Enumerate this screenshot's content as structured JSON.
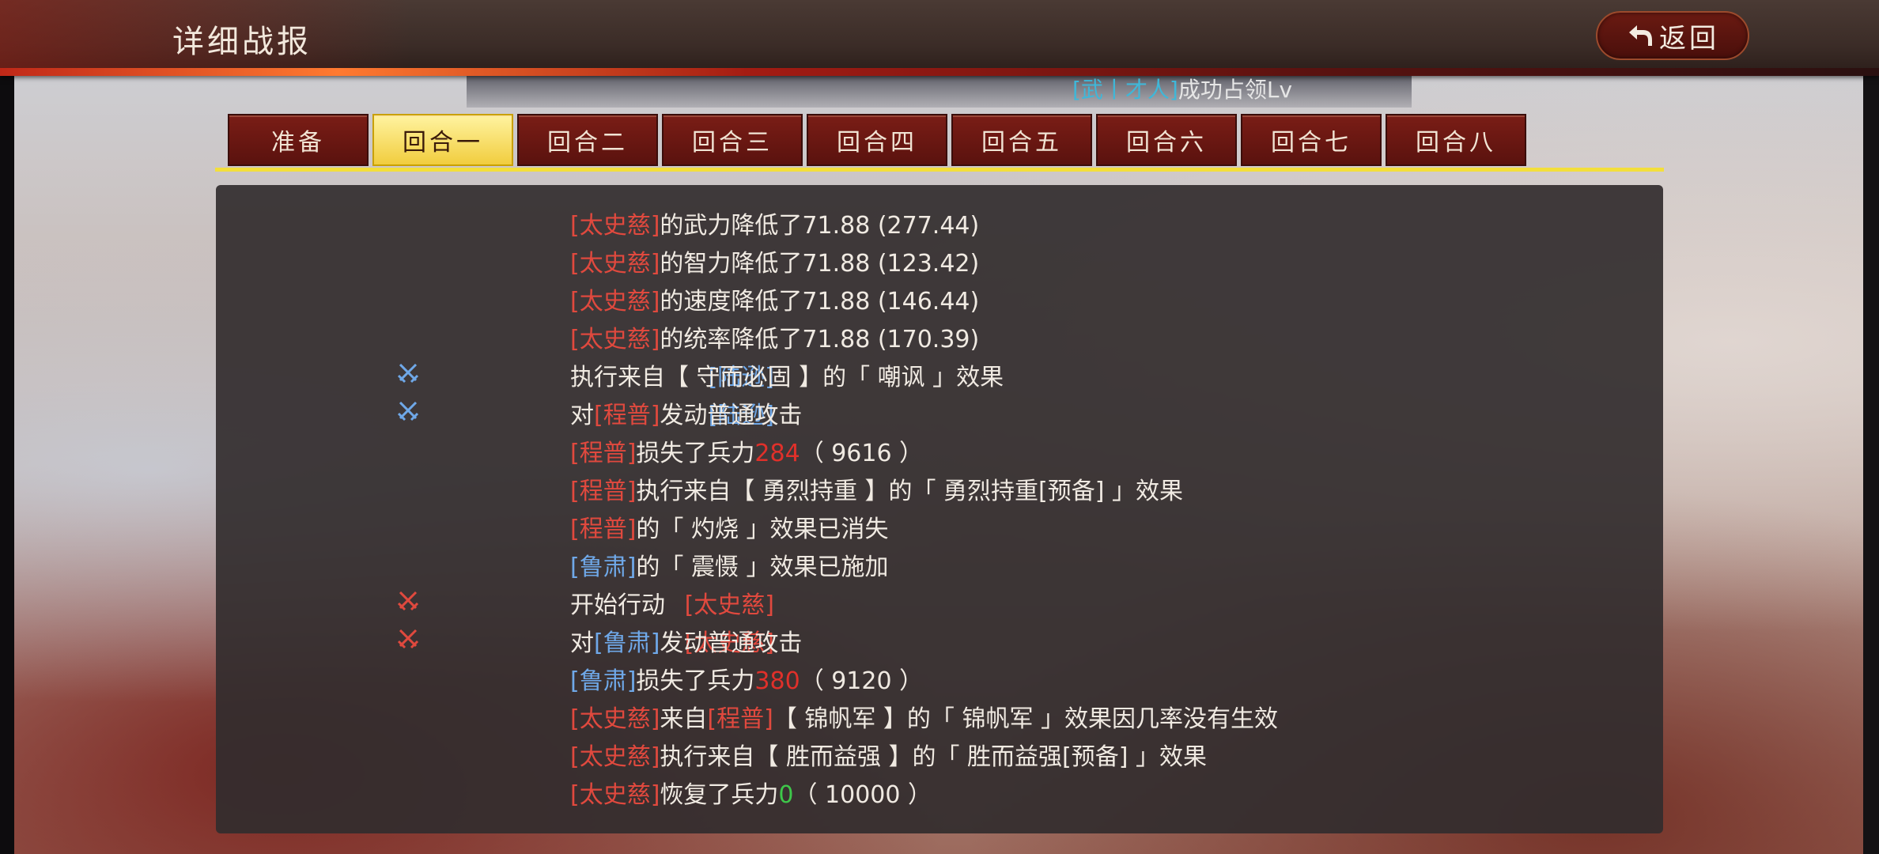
{
  "header": {
    "title": "详细战报",
    "back_label": "返回"
  },
  "occupy_notice": {
    "bracket_name": "[武丨才人]",
    "text": "成功占领Lv"
  },
  "tabs": [
    "准备",
    "回合一",
    "回合二",
    "回合三",
    "回合四",
    "回合五",
    "回合六",
    "回合七",
    "回合八"
  ],
  "active_tab": 1,
  "colors": {
    "red_name": "#e0493e",
    "blue_name": "#6fa8e8",
    "loss": "#e0302a",
    "heal": "#3ec74a",
    "tab_active": "#f3df3b"
  },
  "log": [
    {
      "icon": "",
      "actor": "",
      "actor_color": "",
      "segments": [
        {
          "t": "[太史慈]",
          "c": "red"
        },
        {
          "t": "的武力降低了71.88 (277.44)"
        }
      ]
    },
    {
      "icon": "",
      "actor": "",
      "actor_color": "",
      "segments": [
        {
          "t": "[太史慈]",
          "c": "red"
        },
        {
          "t": "的智力降低了71.88 (123.42)"
        }
      ]
    },
    {
      "icon": "",
      "actor": "",
      "actor_color": "",
      "segments": [
        {
          "t": "[太史慈]",
          "c": "red"
        },
        {
          "t": "的速度降低了71.88 (146.44)"
        }
      ]
    },
    {
      "icon": "",
      "actor": "",
      "actor_color": "",
      "segments": [
        {
          "t": "[太史慈]",
          "c": "red"
        },
        {
          "t": "的统率降低了71.88 (170.39)"
        }
      ]
    },
    {
      "icon": "crossed-swords-blue",
      "actor": "[陆逊]",
      "actor_color": "blue",
      "segments": [
        {
          "t": "执行来自【 守而必固 】的「 嘲讽 」效果"
        }
      ]
    },
    {
      "icon": "crossed-swords-blue",
      "actor": "[陆逊]",
      "actor_color": "blue",
      "segments": [
        {
          "t": "对"
        },
        {
          "t": "[程普]",
          "c": "red"
        },
        {
          "t": "发动普通攻击"
        }
      ]
    },
    {
      "icon": "",
      "actor": "",
      "actor_color": "",
      "segments": [
        {
          "t": "[程普]",
          "c": "red"
        },
        {
          "t": "损失了兵力"
        },
        {
          "t": "284",
          "c": "num-red"
        },
        {
          "t": "（ 9616 ）"
        }
      ]
    },
    {
      "icon": "",
      "actor": "",
      "actor_color": "",
      "segments": [
        {
          "t": "[程普]",
          "c": "red"
        },
        {
          "t": "执行来自【 勇烈持重 】的「 勇烈持重[预备] 」效果"
        }
      ]
    },
    {
      "icon": "",
      "actor": "",
      "actor_color": "",
      "segments": [
        {
          "t": "[程普]",
          "c": "red"
        },
        {
          "t": "的「 灼烧 」效果已消失"
        }
      ]
    },
    {
      "icon": "",
      "actor": "",
      "actor_color": "",
      "segments": [
        {
          "t": "[鲁肃]",
          "c": "blue"
        },
        {
          "t": "的「 震慑 」效果已施加"
        }
      ]
    },
    {
      "icon": "crossed-swords-red",
      "actor": "[太史慈]",
      "actor_color": "red",
      "segments": [
        {
          "t": "开始行动"
        }
      ]
    },
    {
      "icon": "crossed-swords-red",
      "actor": "[太史慈]",
      "actor_color": "red",
      "segments": [
        {
          "t": "对"
        },
        {
          "t": "[鲁肃]",
          "c": "blue"
        },
        {
          "t": "发动普通攻击"
        }
      ]
    },
    {
      "icon": "",
      "actor": "",
      "actor_color": "",
      "segments": [
        {
          "t": "[鲁肃]",
          "c": "blue"
        },
        {
          "t": "损失了兵力"
        },
        {
          "t": "380",
          "c": "num-red"
        },
        {
          "t": "（ 9120 ）"
        }
      ]
    },
    {
      "icon": "",
      "actor": "",
      "actor_color": "",
      "segments": [
        {
          "t": "[太史慈]",
          "c": "red"
        },
        {
          "t": "来自"
        },
        {
          "t": "[程普]",
          "c": "red"
        },
        {
          "t": "【 锦帆军 】的「 锦帆军 」效果因几率没有生效"
        }
      ]
    },
    {
      "icon": "",
      "actor": "",
      "actor_color": "",
      "segments": [
        {
          "t": "[太史慈]",
          "c": "red"
        },
        {
          "t": "执行来自【 胜而益强 】的「 胜而益强[预备] 」效果"
        }
      ]
    },
    {
      "icon": "",
      "actor": "",
      "actor_color": "",
      "segments": [
        {
          "t": "[太史慈]",
          "c": "red"
        },
        {
          "t": "恢复了兵力"
        },
        {
          "t": "0",
          "c": "num-green"
        },
        {
          "t": "（ 10000 ）"
        }
      ]
    }
  ]
}
